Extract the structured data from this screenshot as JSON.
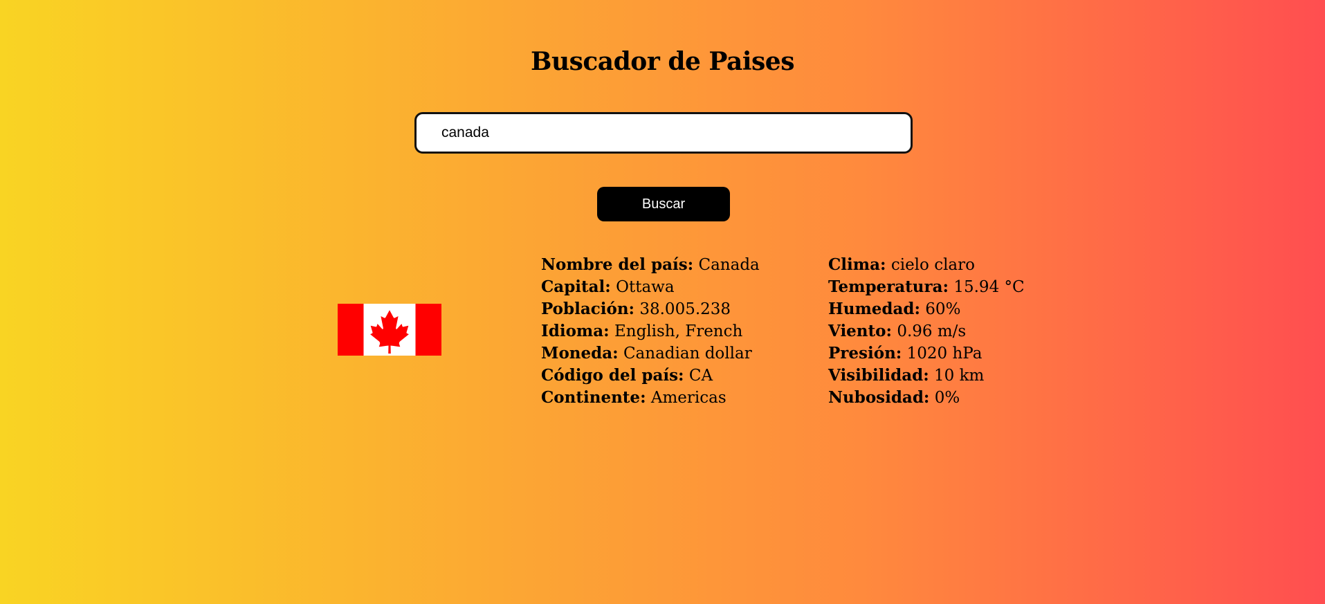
{
  "header": {
    "title": "Buscador de Paises"
  },
  "search": {
    "value": "canada",
    "button_label": "Buscar"
  },
  "country": {
    "flag_icon": "canada-flag-icon",
    "rows": [
      {
        "label": "Nombre del país:",
        "value": "Canada"
      },
      {
        "label": "Capital:",
        "value": "Ottawa"
      },
      {
        "label": "Población:",
        "value": "38.005.238"
      },
      {
        "label": "Idioma:",
        "value": "English, French"
      },
      {
        "label": "Moneda:",
        "value": "Canadian dollar"
      },
      {
        "label": "Código del país:",
        "value": "CA"
      },
      {
        "label": "Continente:",
        "value": "Americas"
      }
    ]
  },
  "weather": {
    "rows": [
      {
        "label": "Clima:",
        "value": "cielo claro"
      },
      {
        "label": "Temperatura:",
        "value": "15.94 °C"
      },
      {
        "label": "Humedad:",
        "value": "60%"
      },
      {
        "label": "Viento:",
        "value": "0.96 m/s"
      },
      {
        "label": "Presión:",
        "value": "1020 hPa"
      },
      {
        "label": "Visibilidad:",
        "value": "10 km"
      },
      {
        "label": "Nubosidad:",
        "value": "0%"
      }
    ]
  },
  "colors": {
    "gradient_start": "#f9d423",
    "gradient_end": "#ff4e50",
    "button_bg": "#000000",
    "flag_red": "#ff0000"
  }
}
